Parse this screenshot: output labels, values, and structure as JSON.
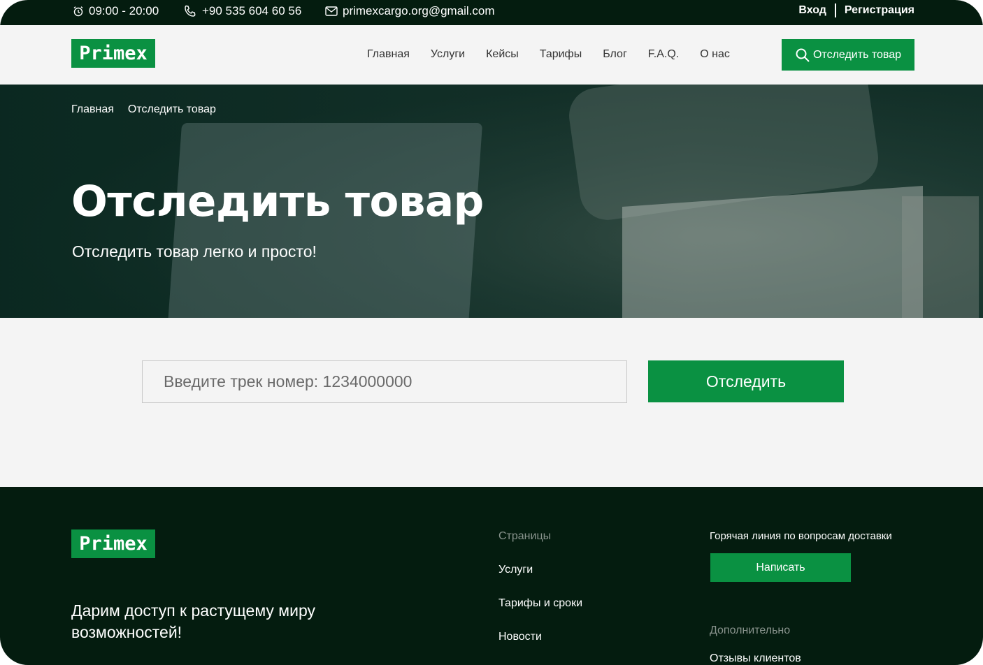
{
  "topbar": {
    "hours": "09:00 - 20:00",
    "phone": "+90 535 604 60 56",
    "email": "primexcargo.org@gmail.com",
    "login": "Вход",
    "register": "Регистрация"
  },
  "header": {
    "logo": "Primex",
    "nav": [
      "Главная",
      "Услуги",
      "Кейсы",
      "Тарифы",
      "Блог",
      "F.A.Q.",
      "О нас"
    ],
    "track_button": "Отследить товар"
  },
  "hero": {
    "breadcrumb": [
      "Главная",
      "Отследить товар"
    ],
    "title": "Отследить товар",
    "subtitle": "Отследить товар легко и просто!"
  },
  "tracking_form": {
    "placeholder": "Введите трек номер: 1234000000",
    "submit_label": "Отследить"
  },
  "footer": {
    "logo": "Primex",
    "tagline": "Дарим доступ к растущему миру возможностей!",
    "pages_title": "Страницы",
    "pages_links": [
      "Услуги",
      "Тарифы и сроки",
      "Новости"
    ],
    "hotline": "Горячая линия по вопросам доставки",
    "write_button": "Написать",
    "extra_title": "Дополнительно",
    "extra_links": [
      "Отзывы клиентов"
    ]
  },
  "colors": {
    "brand_green": "#0a9142",
    "dark_green": "#041c0f",
    "background": "#f4f4f4"
  }
}
